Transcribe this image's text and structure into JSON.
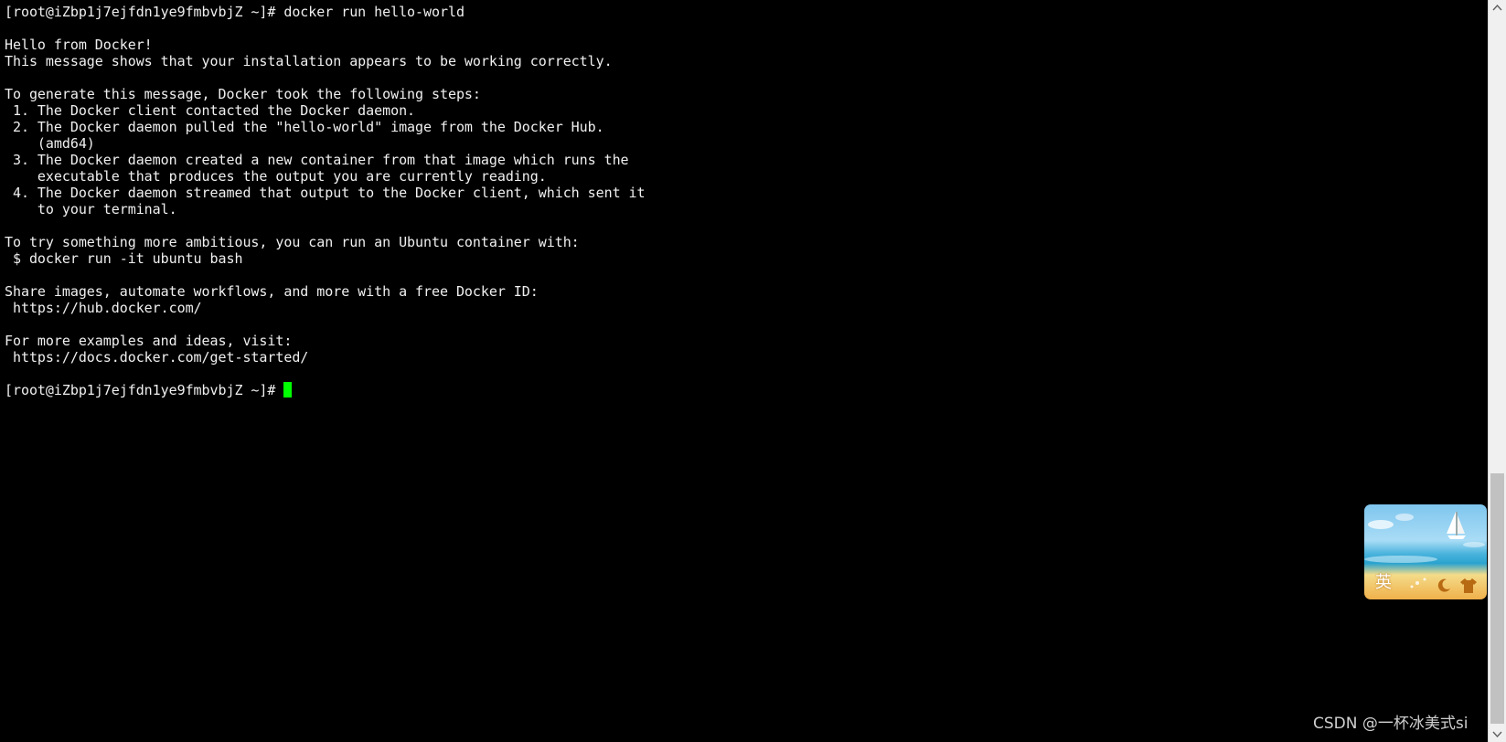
{
  "terminal": {
    "lines": [
      "[root@iZbp1j7ejfdn1ye9fmbvbjZ ~]# docker run hello-world",
      "",
      "Hello from Docker!",
      "This message shows that your installation appears to be working correctly.",
      "",
      "To generate this message, Docker took the following steps:",
      " 1. The Docker client contacted the Docker daemon.",
      " 2. The Docker daemon pulled the \"hello-world\" image from the Docker Hub.",
      "    (amd64)",
      " 3. The Docker daemon created a new container from that image which runs the",
      "    executable that produces the output you are currently reading.",
      " 4. The Docker daemon streamed that output to the Docker client, which sent it",
      "    to your terminal.",
      "",
      "To try something more ambitious, you can run an Ubuntu container with:",
      " $ docker run -it ubuntu bash",
      "",
      "Share images, automate workflows, and more with a free Docker ID:",
      " https://hub.docker.com/",
      "",
      "For more examples and ideas, visit:",
      " https://docs.docker.com/get-started/",
      "",
      "[root@iZbp1j7ejfdn1ye9fmbvbjZ ~]# "
    ],
    "text_color": "#f0f0f0",
    "background_color": "#000000",
    "cursor_color": "#00ff00"
  },
  "ime": {
    "mode_label": "英",
    "icons": [
      "sailboat-icon",
      "moon-icon",
      "shirt-icon"
    ]
  },
  "watermark": {
    "text": "CSDN @一杯冰美式si"
  },
  "scrollbar": {
    "up_icon": "chevron-up-icon",
    "down_icon": "chevron-down-icon"
  }
}
